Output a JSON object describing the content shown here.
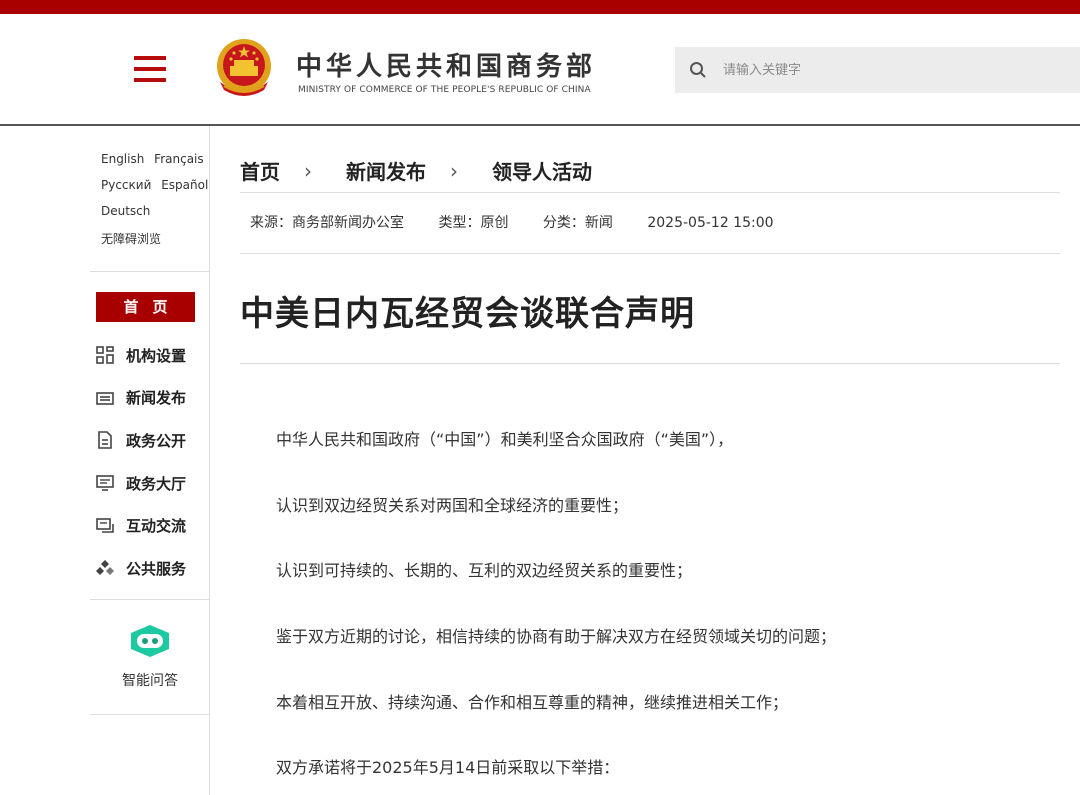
{
  "header": {
    "site_name_cn": "中华人民共和国商务部",
    "site_name_en": "MINISTRY OF COMMERCE OF THE PEOPLE'S REPUBLIC OF CHINA",
    "search_placeholder": "请输入关键字",
    "accent_color": "#a80000"
  },
  "sidebar": {
    "languages": [
      [
        "English",
        "Français"
      ],
      [
        "Русский",
        "Español"
      ],
      [
        "Deutsch"
      ],
      [
        "无障碍浏览"
      ]
    ],
    "home_label": "首页",
    "nav_items": [
      {
        "label": "机构设置",
        "icon": "grid-icon"
      },
      {
        "label": "新闻发布",
        "icon": "news-icon"
      },
      {
        "label": "政务公开",
        "icon": "document-icon"
      },
      {
        "label": "政务大厅",
        "icon": "monitor-icon"
      },
      {
        "label": "互动交流",
        "icon": "chat-icon"
      },
      {
        "label": "公共服务",
        "icon": "service-icon"
      }
    ],
    "ai_label": "智能问答"
  },
  "breadcrumb": [
    "首页",
    "新闻发布",
    "领导人活动"
  ],
  "meta": {
    "source": "来源：商务部新闻办公室",
    "type": "类型：原创",
    "category": "分类：新闻",
    "datetime": "2025-05-12 15:00"
  },
  "article": {
    "title": "中美日内瓦经贸会谈联合声明",
    "paragraphs": [
      "中华人民共和国政府（“中国”）和美利坚合众国政府（“美国”），",
      "认识到双边经贸关系对两国和全球经济的重要性；",
      "认识到可持续的、长期的、互利的双边经贸关系的重要性；",
      "鉴于双方近期的讨论，相信持续的协商有助于解决双方在经贸领域关切的问题；",
      "本着相互开放、持续沟通、合作和相互尊重的精神，继续推进相关工作；",
      "双方承诺将于2025年5月14日前采取以下举措："
    ]
  }
}
